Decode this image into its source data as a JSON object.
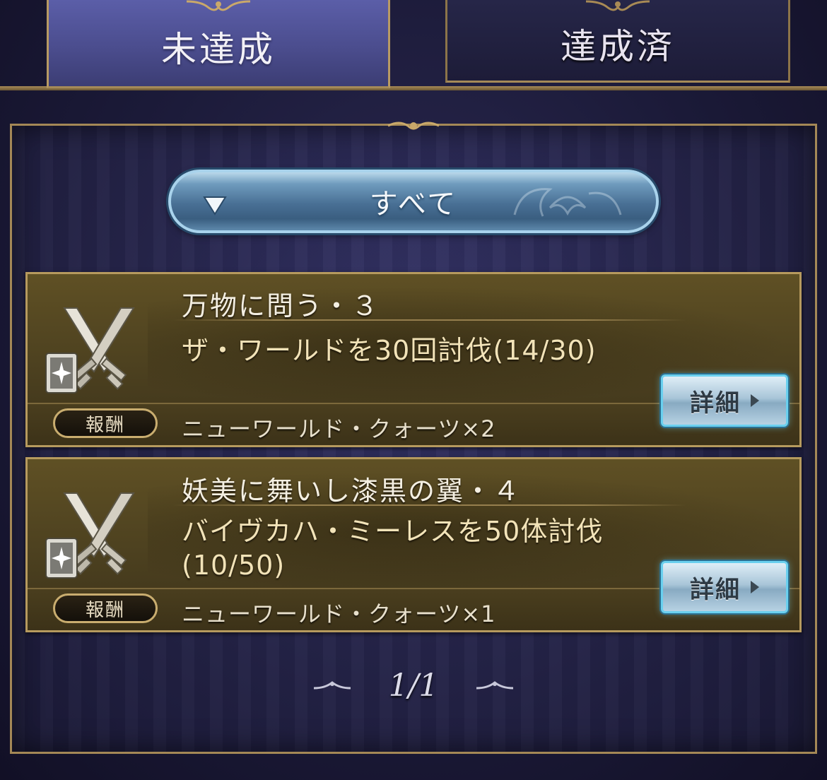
{
  "tabs": [
    {
      "label": "未達成",
      "active": true
    },
    {
      "label": "達成済",
      "active": false
    }
  ],
  "filter": {
    "selected": "すべて"
  },
  "quests": [
    {
      "title": "万物に問う・３",
      "description": "ザ・ワールドを30回討伐(14/30)",
      "progress": {
        "current": 14,
        "target": 30
      },
      "reward_label": "報酬",
      "reward": "ニューワールド・クォーツ×2",
      "detail_label": "詳細",
      "icon": "crossed-swords-icon"
    },
    {
      "title": "妖美に舞いし漆黒の翼・４",
      "description": "バイヴカハ・ミーレスを50体討伐(10/50)",
      "progress": {
        "current": 10,
        "target": 50
      },
      "reward_label": "報酬",
      "reward": "ニューワールド・クォーツ×1",
      "detail_label": "詳細",
      "icon": "crossed-swords-icon"
    }
  ],
  "pagination": {
    "label": "1/1"
  },
  "colors": {
    "gold_border": "#b69a5e",
    "active_tab": "#4b4d8e",
    "filter_blue": "#486f94",
    "detail_glow": "#6ad0ef"
  }
}
